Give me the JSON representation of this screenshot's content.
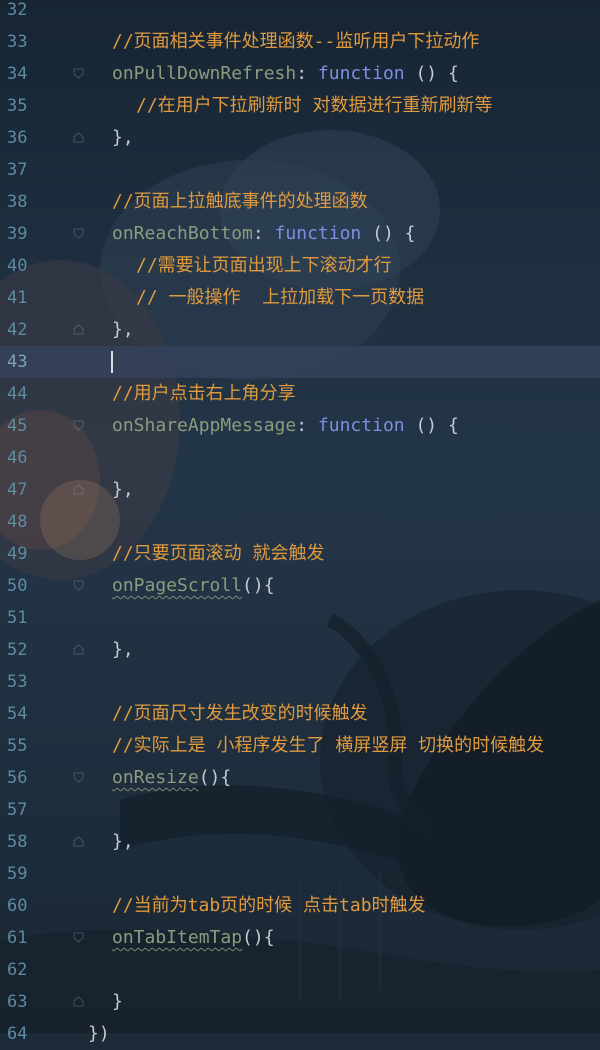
{
  "colors": {
    "background": "#1d2b38",
    "line_number": "#5d8ba2",
    "comment": "#e09a3d",
    "property": "#8c9c7e",
    "keyword": "#7e8fe3",
    "punctuation": "#c7cbd1",
    "current_line": "#34425c"
  },
  "editor": {
    "current_line_number": "43",
    "lines": [
      {
        "num": "32",
        "indent": 1,
        "tokens": []
      },
      {
        "num": "33",
        "indent": 1,
        "tokens": [
          {
            "t": "c",
            "s": "//页面相关事件处理函数--监听用户下拉动作"
          }
        ]
      },
      {
        "num": "34",
        "indent": 1,
        "fold": "open",
        "tokens": [
          {
            "t": "p",
            "s": "onPullDownRefresh"
          },
          {
            "t": "x",
            "s": ": "
          },
          {
            "t": "k",
            "s": "function"
          },
          {
            "t": "x",
            "s": " () {"
          }
        ]
      },
      {
        "num": "35",
        "indent": 2,
        "tokens": [
          {
            "t": "c",
            "s": "//在用户下拉刷新时 对数据进行重新刷新等"
          }
        ]
      },
      {
        "num": "36",
        "indent": 1,
        "fold": "close",
        "tokens": [
          {
            "t": "x",
            "s": "},"
          }
        ]
      },
      {
        "num": "37",
        "indent": 1,
        "tokens": []
      },
      {
        "num": "38",
        "indent": 1,
        "tokens": [
          {
            "t": "c",
            "s": "//页面上拉触底事件的处理函数"
          }
        ]
      },
      {
        "num": "39",
        "indent": 1,
        "fold": "open",
        "tokens": [
          {
            "t": "p",
            "s": "onReachBottom"
          },
          {
            "t": "x",
            "s": ": "
          },
          {
            "t": "k",
            "s": "function"
          },
          {
            "t": "x",
            "s": " () {"
          }
        ]
      },
      {
        "num": "40",
        "indent": 2,
        "tokens": [
          {
            "t": "c",
            "s": "//需要让页面出现上下滚动才行"
          }
        ]
      },
      {
        "num": "41",
        "indent": 2,
        "tokens": [
          {
            "t": "c",
            "s": "// 一般操作  上拉加载下一页数据"
          }
        ]
      },
      {
        "num": "42",
        "indent": 1,
        "fold": "close",
        "tokens": [
          {
            "t": "x",
            "s": "},"
          }
        ]
      },
      {
        "num": "43",
        "indent": 1,
        "tokens": [],
        "cursor": true
      },
      {
        "num": "44",
        "indent": 1,
        "tokens": [
          {
            "t": "c",
            "s": "//用户点击右上角分享"
          }
        ]
      },
      {
        "num": "45",
        "indent": 1,
        "fold": "open",
        "tokens": [
          {
            "t": "p",
            "s": "onShareAppMessage"
          },
          {
            "t": "x",
            "s": ": "
          },
          {
            "t": "k",
            "s": "function"
          },
          {
            "t": "x",
            "s": " () {"
          }
        ]
      },
      {
        "num": "46",
        "indent": 1,
        "tokens": []
      },
      {
        "num": "47",
        "indent": 1,
        "fold": "close",
        "tokens": [
          {
            "t": "x",
            "s": "},"
          }
        ]
      },
      {
        "num": "48",
        "indent": 1,
        "tokens": []
      },
      {
        "num": "49",
        "indent": 1,
        "tokens": [
          {
            "t": "c",
            "s": "//只要页面滚动 就会触发"
          }
        ]
      },
      {
        "num": "50",
        "indent": 1,
        "fold": "open",
        "tokens": [
          {
            "t": "ps",
            "s": "onPageScroll"
          },
          {
            "t": "x",
            "s": "(){"
          }
        ]
      },
      {
        "num": "51",
        "indent": 1,
        "tokens": []
      },
      {
        "num": "52",
        "indent": 1,
        "fold": "close",
        "tokens": [
          {
            "t": "x",
            "s": "},"
          }
        ]
      },
      {
        "num": "53",
        "indent": 1,
        "tokens": []
      },
      {
        "num": "54",
        "indent": 1,
        "tokens": [
          {
            "t": "c",
            "s": "//页面尺寸发生改变的时候触发"
          }
        ]
      },
      {
        "num": "55",
        "indent": 1,
        "tokens": [
          {
            "t": "c",
            "s": "//实际上是 小程序发生了 横屏竖屏 切换的时候触发"
          }
        ]
      },
      {
        "num": "56",
        "indent": 1,
        "fold": "open",
        "tokens": [
          {
            "t": "ps",
            "s": "onResize"
          },
          {
            "t": "x",
            "s": "(){"
          }
        ]
      },
      {
        "num": "57",
        "indent": 1,
        "tokens": []
      },
      {
        "num": "58",
        "indent": 1,
        "fold": "close",
        "tokens": [
          {
            "t": "x",
            "s": "},"
          }
        ]
      },
      {
        "num": "59",
        "indent": 1,
        "tokens": []
      },
      {
        "num": "60",
        "indent": 1,
        "tokens": [
          {
            "t": "c",
            "s": "//当前为tab页的时候 点击tab时触发"
          }
        ]
      },
      {
        "num": "61",
        "indent": 1,
        "fold": "open",
        "tokens": [
          {
            "t": "ps",
            "s": "onTabItemTap"
          },
          {
            "t": "x",
            "s": "(){"
          }
        ]
      },
      {
        "num": "62",
        "indent": 1,
        "tokens": []
      },
      {
        "num": "63",
        "indent": 1,
        "fold": "close",
        "tokens": [
          {
            "t": "x",
            "s": "}"
          }
        ]
      },
      {
        "num": "64",
        "indent": 0,
        "tokens": [
          {
            "t": "x",
            "s": "})"
          }
        ]
      }
    ]
  }
}
